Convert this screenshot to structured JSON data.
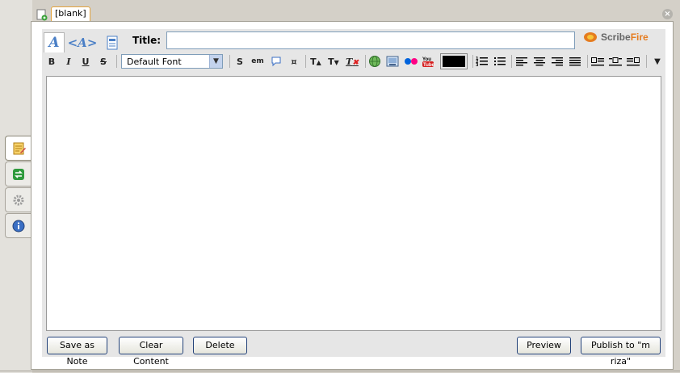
{
  "tab": {
    "label": "[blank]"
  },
  "editor": {
    "title_label": "Title:",
    "title_value": "",
    "logo": {
      "part1": "Scribe",
      "part2": "Fire"
    }
  },
  "toolbar": {
    "bold": "B",
    "italic": "I",
    "underline": "U",
    "strike": "S",
    "font": "Default Font",
    "strong": "S",
    "em": "em"
  },
  "buttons": {
    "save_note": "Save as Note",
    "clear": "Clear Content",
    "delete": "Delete",
    "preview": "Preview",
    "publish": "Publish to \"m riza\""
  },
  "icons": {
    "sidebar": [
      "editor-icon",
      "blogs-icon",
      "settings-icon",
      "info-icon"
    ]
  },
  "colors": {
    "accent": "#e57c1f",
    "text_color_swatch": "#000000",
    "button_border": "#24437a"
  }
}
